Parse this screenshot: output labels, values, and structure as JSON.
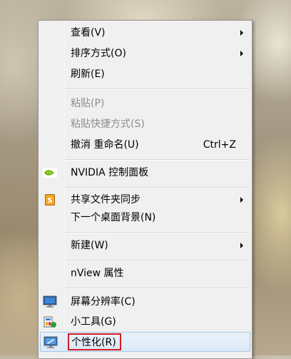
{
  "menu": {
    "items": [
      {
        "label": "查看(V)",
        "submenu": true
      },
      {
        "label": "排序方式(O)",
        "submenu": true
      },
      {
        "label": "刷新(E)"
      },
      {
        "label": "粘贴(P)",
        "disabled": true
      },
      {
        "label": "粘贴快捷方式(S)",
        "disabled": true
      },
      {
        "label": "撤消 重命名(U)",
        "shortcut": "Ctrl+Z"
      },
      {
        "label": "NVIDIA 控制面板",
        "icon": "nvidia-icon"
      },
      {
        "label": "共享文件夹同步",
        "icon": "sync-share-icon",
        "submenu": true
      },
      {
        "label": "下一个桌面背景(N)"
      },
      {
        "label": "新建(W)",
        "submenu": true
      },
      {
        "label": "nView 属性"
      },
      {
        "label": "屏幕分辨率(C)",
        "icon": "screen-resolution-icon"
      },
      {
        "label": "小工具(G)",
        "icon": "gadgets-icon"
      },
      {
        "label": "个性化(R)",
        "icon": "personalize-icon",
        "highlighted": true
      }
    ]
  },
  "colors": {
    "highlight_box": "#d21d25",
    "nvidia_green": "#76b900"
  }
}
